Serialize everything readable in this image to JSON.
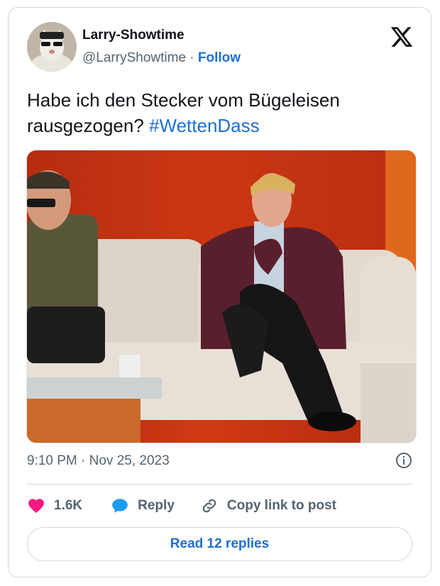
{
  "author": {
    "display_name": "Larry-Showtime",
    "handle": "@LarryShowtime",
    "separator": "·",
    "follow_label": "Follow"
  },
  "tweet": {
    "text": "Habe ich den Stecker vom Bügeleisen rausgezogen?",
    "hashtag": "#WettenDass",
    "timestamp": "9:10 PM · Nov 25, 2023"
  },
  "actions": {
    "likes": "1.6K",
    "reply_label": "Reply",
    "copy_link_label": "Copy link to post",
    "read_replies_label": "Read 12 replies"
  },
  "icons": {
    "logo": "x-logo-icon",
    "like": "heart-icon",
    "reply": "speech-bubble-icon",
    "copy": "link-icon",
    "info": "info-icon"
  },
  "colors": {
    "link_blue": "#1d6fd6",
    "like_pink": "#f91880",
    "reply_blue": "#1d9bf0",
    "muted": "#536471"
  }
}
